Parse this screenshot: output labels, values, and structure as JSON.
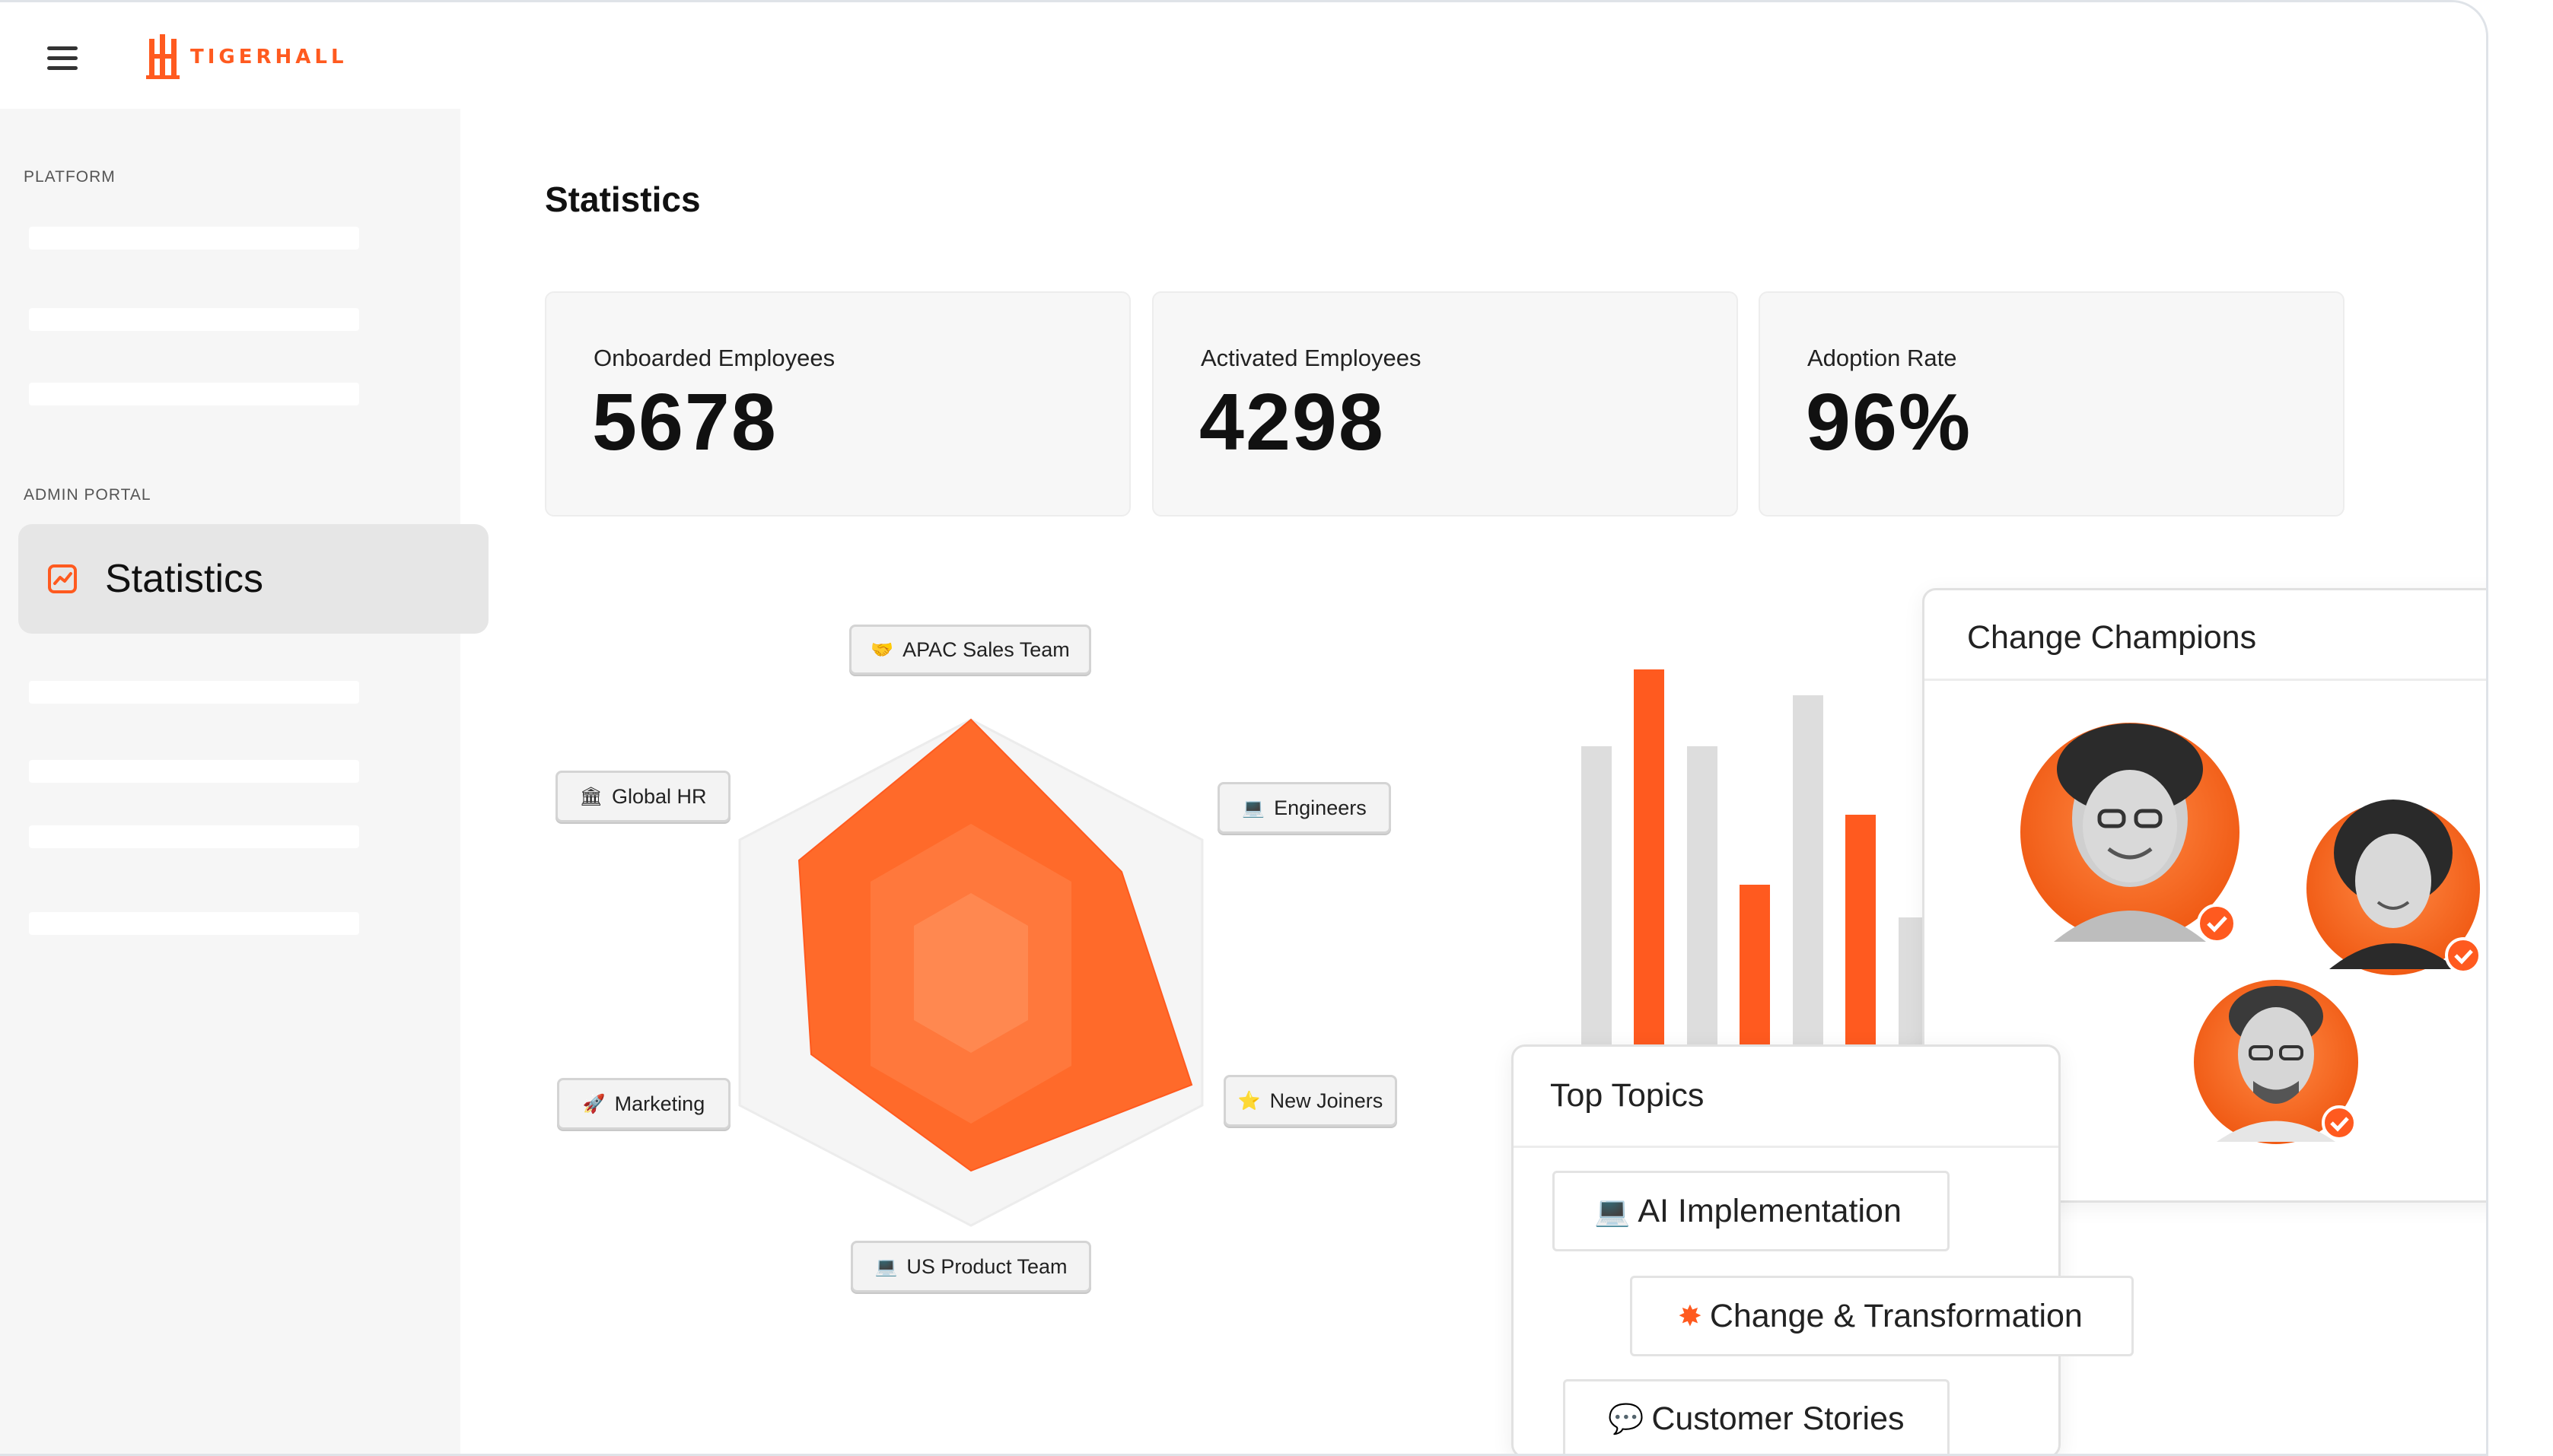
{
  "brand": {
    "name": "TIGERHALL",
    "color": "#ff5a1f"
  },
  "header": {
    "menu_icon": "hamburger-menu-icon"
  },
  "sidebar": {
    "platform_label": "PLATFORM",
    "admin_label": "ADMIN PORTAL",
    "active_item": {
      "label": "Statistics",
      "icon": "chart-icon"
    }
  },
  "main": {
    "title": "Statistics",
    "stats": [
      {
        "label": "Onboarded Employees",
        "value": "5678"
      },
      {
        "label": "Activated Employees",
        "value": "4298"
      },
      {
        "label": "Adoption Rate",
        "value": "96%"
      }
    ]
  },
  "radar": {
    "axes": [
      {
        "label": "APAC Sales Team",
        "icon": "handshake-icon",
        "emoji": "🤝"
      },
      {
        "label": "Engineers",
        "icon": "laptop-icon",
        "emoji": "💻"
      },
      {
        "label": "New Joiners",
        "icon": "star-icon",
        "emoji": "⭐"
      },
      {
        "label": "US Product Team",
        "icon": "laptop-icon",
        "emoji": "💻"
      },
      {
        "label": "Marketing",
        "icon": "rocket-icon",
        "emoji": "🚀"
      },
      {
        "label": "Global HR",
        "icon": "bank-icon",
        "emoji": "🏛"
      }
    ]
  },
  "change_champions": {
    "title": "Change Champions"
  },
  "top_topics": {
    "title": "Top Topics",
    "items": [
      {
        "label": "AI Implementation",
        "icon": "laptop-icon",
        "emoji": "💻"
      },
      {
        "label": "Change & Transformation",
        "icon": "sparkle-icon",
        "emoji": "✸"
      },
      {
        "label": "Customer Stories",
        "icon": "speech-bubble-icon",
        "emoji": "💬"
      }
    ]
  },
  "colors": {
    "accent": "#ff5a1f",
    "bar_gray": "#dddddd",
    "card_bg": "#f7f7f7"
  }
}
